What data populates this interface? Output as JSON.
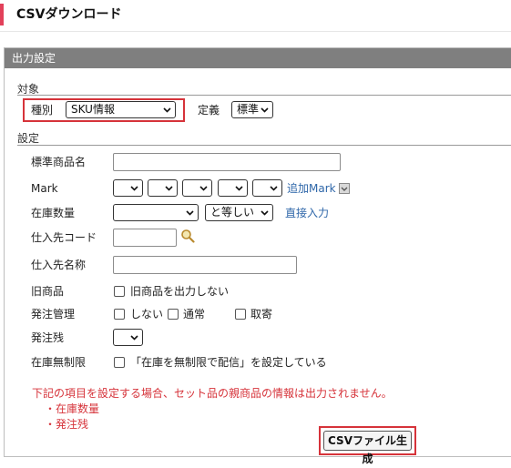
{
  "page": {
    "title": "CSVダウンロード"
  },
  "panel": {
    "header": "出力設定"
  },
  "target": {
    "section_label": "対象",
    "type_label": "種別",
    "type_value": "SKU情報",
    "definition_label": "定義",
    "definition_value": "標準"
  },
  "settings": {
    "section_label": "設定",
    "standard_product_name_label": "標準商品名",
    "mark_label": "Mark",
    "add_mark_link": "追加Mark",
    "stock_qty_label": "在庫数量",
    "stock_compare_value": "と等しい",
    "direct_input_link": "直接入力",
    "supplier_code_label": "仕入先コード",
    "supplier_name_label": "仕入先名称",
    "old_product_label": "旧商品",
    "old_product_option": "旧商品を出力しない",
    "order_mgmt_label": "発注管理",
    "order_mgmt_options": [
      "しない",
      "通常",
      "取寄"
    ],
    "order_remaining_label": "発注残",
    "unlimited_stock_label": "在庫無制限",
    "unlimited_stock_option": "「在庫を無制限で配信」を設定している"
  },
  "warning": {
    "message": "下記の項目を設定する場合、セット品の親商品の情報は出力されません。",
    "items": [
      "・在庫数量",
      "・発注残"
    ]
  },
  "actions": {
    "generate_csv": "CSVファイル生成"
  },
  "colors": {
    "accent": "#e2405a",
    "highlight": "#d6333a",
    "header_bg": "#7f7f7f",
    "link": "#2f67a9"
  }
}
